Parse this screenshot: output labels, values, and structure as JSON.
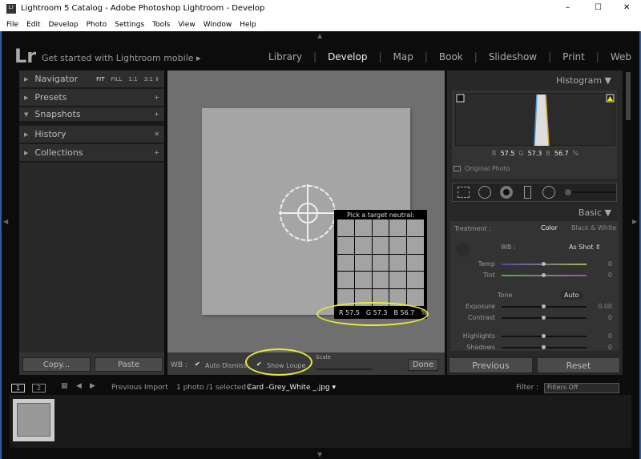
{
  "window": {
    "title": "Lightroom 5 Catalog - Adobe Photoshop Lightroom - Develop",
    "controls": [
      "–",
      "☐",
      "✕"
    ]
  },
  "menu": [
    "File",
    "Edit",
    "Develop",
    "Photo",
    "Settings",
    "Tools",
    "View",
    "Window",
    "Help"
  ],
  "header": {
    "logo": "Lr",
    "mobile": "Get started with Lightroom mobile ▸",
    "modules": [
      "Library",
      "Develop",
      "Map",
      "Book",
      "Slideshow",
      "Print",
      "Web"
    ],
    "active": "Develop"
  },
  "left": {
    "navigator": {
      "label": "Navigator",
      "zoom": [
        "FIT",
        "FILL",
        "1:1",
        "3:1 ⇕"
      ]
    },
    "panels": [
      {
        "label": "Presets",
        "icon": "+"
      },
      {
        "label": "Snapshots",
        "icon": "+"
      },
      {
        "label": "History",
        "icon": "✕"
      },
      {
        "label": "Collections",
        "icon": "+"
      }
    ],
    "copy": "Copy...",
    "paste": "Paste"
  },
  "loupe": {
    "title": "Pick a target neutral:",
    "r": "R 57.5",
    "g": "G 57.3",
    "b": "B 56.7",
    "pct": "%"
  },
  "toolbar": {
    "wb": "WB :",
    "auto_dismiss": "Auto Dismiss",
    "show_loupe": "Show Loupe",
    "scale": "Scale",
    "done": "Done",
    "auto_dismiss_checked": true,
    "show_loupe_checked": true
  },
  "right": {
    "histogram": {
      "title": "Histogram ▼",
      "r_label": "R",
      "r": "57.5",
      "g_label": "G",
      "g": "57.3",
      "b_label": "B",
      "b": "56.7",
      "pct": "%",
      "original": "Original Photo"
    },
    "basic": {
      "title": "Basic ▼",
      "treatment": "Treatment :",
      "color": "Color",
      "bw": "Black & White",
      "wb": "WB :",
      "wb_value": "As Shot ⇕",
      "tone": "Tone",
      "auto": "Auto",
      "sliders": [
        {
          "label": "Temp",
          "value": "0"
        },
        {
          "label": "Tint",
          "value": "0"
        },
        {
          "label": "Exposure",
          "value": "0.00"
        },
        {
          "label": "Contrast",
          "value": "0"
        },
        {
          "label": "Highlights",
          "value": "0"
        },
        {
          "label": "Shadows",
          "value": "0"
        }
      ]
    },
    "previous": "Previous",
    "reset": "Reset"
  },
  "filmstrip": {
    "view1": "1",
    "view2": "2",
    "source": "Previous Import",
    "info": "1 photo /1 selected /",
    "file": "Card -Grey_White _.jpg ▾",
    "filter_label": "Filter :",
    "filter_value": "Filters Off"
  },
  "colors": {
    "annotation": "#e8e83a",
    "accent_highlight": "#eeeeee"
  }
}
